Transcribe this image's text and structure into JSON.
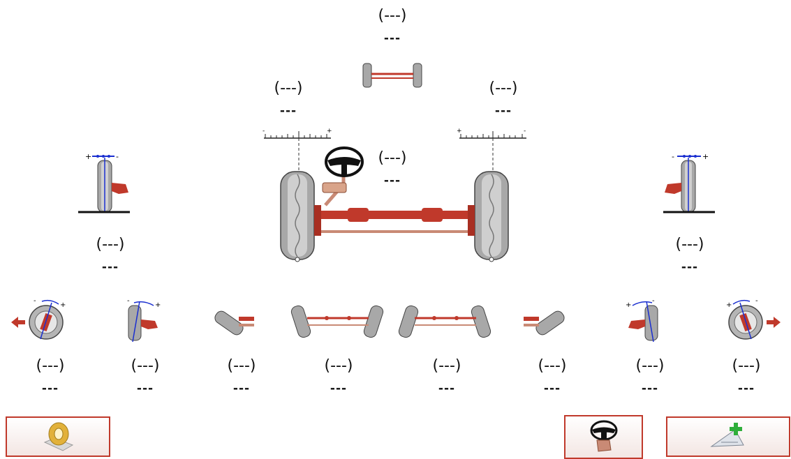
{
  "readouts": {
    "thrust": {
      "paren": "(---)",
      "val": "---"
    },
    "left_toe": {
      "paren": "(---)",
      "val": "---"
    },
    "right_toe": {
      "paren": "(---)",
      "val": "---"
    },
    "steering": {
      "paren": "(---)",
      "val": "---"
    },
    "left_camber": {
      "paren": "(---)",
      "val": "---"
    },
    "right_camber": {
      "paren": "(---)",
      "val": "---"
    },
    "bottom": [
      {
        "paren": "(---)",
        "val": "---"
      },
      {
        "paren": "(---)",
        "val": "---"
      },
      {
        "paren": "(---)",
        "val": "---"
      },
      {
        "paren": "(---)",
        "val": "---"
      },
      {
        "paren": "(---)",
        "val": "---"
      },
      {
        "paren": "(---)",
        "val": "---"
      },
      {
        "paren": "(---)",
        "val": "---"
      },
      {
        "paren": "(---)",
        "val": "---"
      }
    ]
  },
  "icons": {
    "left_button": "tape-roll-icon",
    "middle_button": "steering-wheel-hand-icon",
    "right_button": "add-measurement-icon"
  },
  "colors": {
    "accent": "#c0392b",
    "scale_blue": "#1a2fd0",
    "tire": "#9a9a9a"
  }
}
